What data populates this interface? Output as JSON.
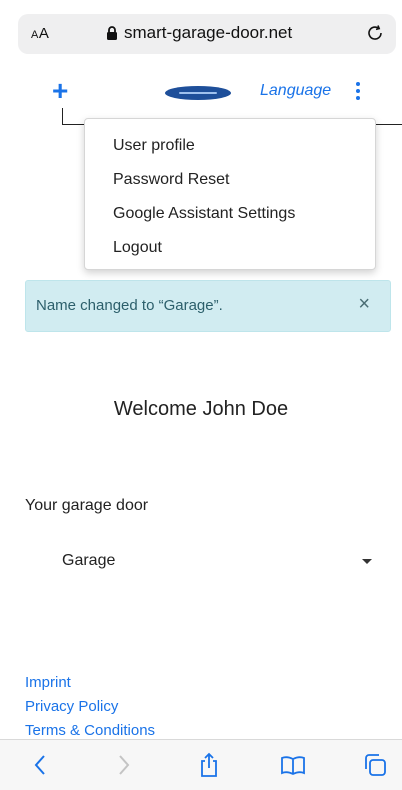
{
  "browser": {
    "reader_label_small": "A",
    "reader_label_large": "A",
    "url": "smart-garage-door.net"
  },
  "header": {
    "add_label": "+",
    "language_label": "Language"
  },
  "menu": {
    "items": [
      "User profile",
      "Password Reset",
      "Google Assistant Settings",
      "Logout"
    ]
  },
  "alert": {
    "message": "Name changed to “Garage”.",
    "close_label": "×"
  },
  "main": {
    "welcome": "Welcome John Doe",
    "door_label": "Your garage door",
    "door_selected": "Garage"
  },
  "footer": {
    "links": [
      "Imprint",
      "Privacy Policy",
      "Terms & Conditions"
    ]
  },
  "colors": {
    "accent": "#1a73e8",
    "alert_bg": "#d1ecf1",
    "logo_blue": "#1e4f9a"
  },
  "icons": [
    "lock-icon",
    "reload-icon",
    "plus-icon",
    "kebab-menu-icon",
    "close-icon",
    "back-icon",
    "forward-icon",
    "share-icon",
    "bookmarks-icon",
    "tabs-icon"
  ]
}
